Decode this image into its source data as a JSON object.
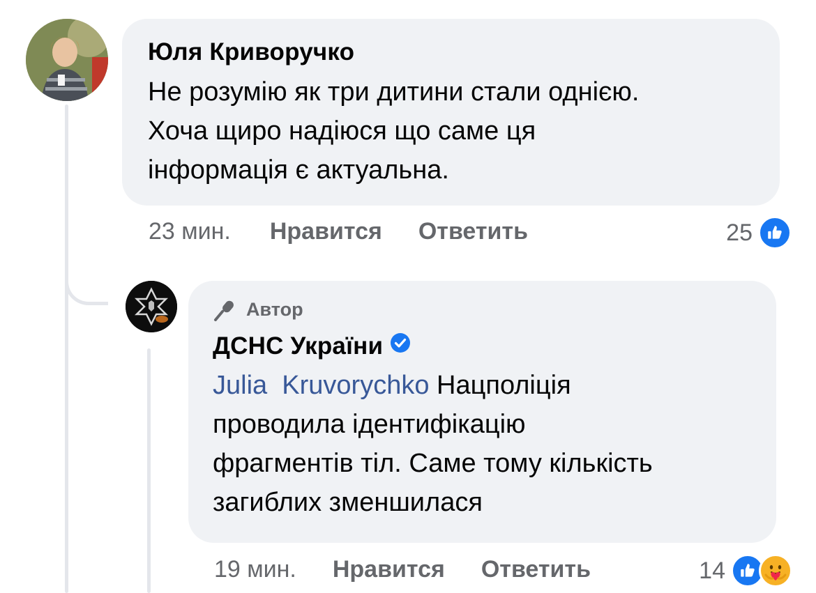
{
  "comment": {
    "author": "Юля Криворучко",
    "text_lines": [
      "Не розумію як три дитини стали однією.",
      "Хоча щиро надіюся що саме ця",
      "інформація є актуальна."
    ],
    "time": "23 мин.",
    "like_label": "Нравится",
    "reply_label": "Ответить",
    "reaction_count": "25",
    "reactions": [
      "like-icon"
    ]
  },
  "reply": {
    "badge_label": "Автор",
    "author": "ДСНС України",
    "verified": true,
    "mention": "Julia  Kruvorychko",
    "text_first_line_rest": "Нацполіція",
    "text_lines": [
      "проводила ідентифікацію",
      "фрагментів тіл. Саме тому кількість",
      "загиблих зменшилася"
    ],
    "time": "19 мин.",
    "like_label": "Нравится",
    "reply_label": "Ответить",
    "reaction_count": "14",
    "reactions": [
      "like-icon",
      "care-icon"
    ]
  },
  "colors": {
    "bubble": "#f0f2f5",
    "meta_text": "#65676b",
    "mention": "#385898",
    "like_blue": "#1877f2",
    "care_yellow": "#f7b125",
    "thread_line": "#e4e6eb"
  }
}
